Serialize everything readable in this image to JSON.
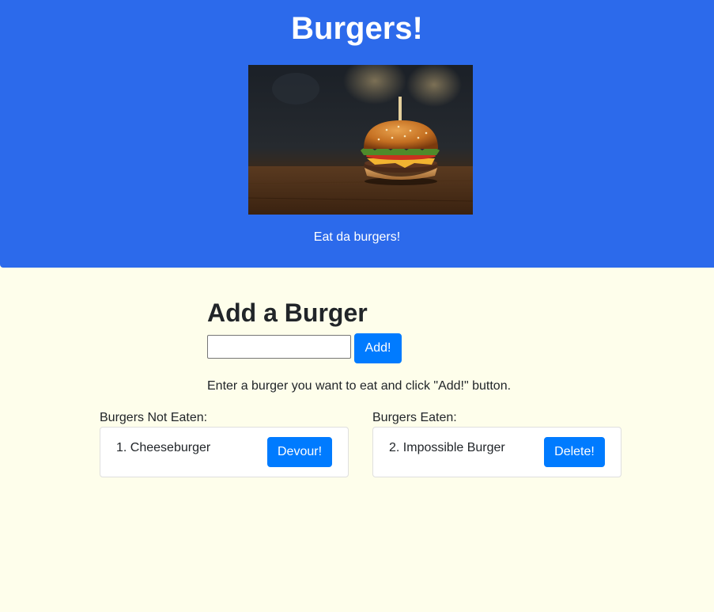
{
  "header": {
    "title": "Burgers!",
    "tagline": "Eat da burgers!",
    "image_alt": "burger photo"
  },
  "add_form": {
    "heading": "Add a Burger",
    "input_value": "",
    "input_placeholder": "",
    "add_button_label": "Add!",
    "help_text": "Enter a burger you want to eat and click \"Add!\" button."
  },
  "not_eaten": {
    "label": "Burgers Not Eaten:",
    "items": [
      {
        "text": "1. Cheeseburger",
        "button_label": "Devour!"
      }
    ]
  },
  "eaten": {
    "label": "Burgers Eaten:",
    "items": [
      {
        "text": "2. Impossible Burger",
        "button_label": "Delete!"
      }
    ]
  },
  "colors": {
    "header_bg": "#2c6aeb",
    "page_bg": "#fefeeb",
    "button_primary": "#007bff"
  }
}
